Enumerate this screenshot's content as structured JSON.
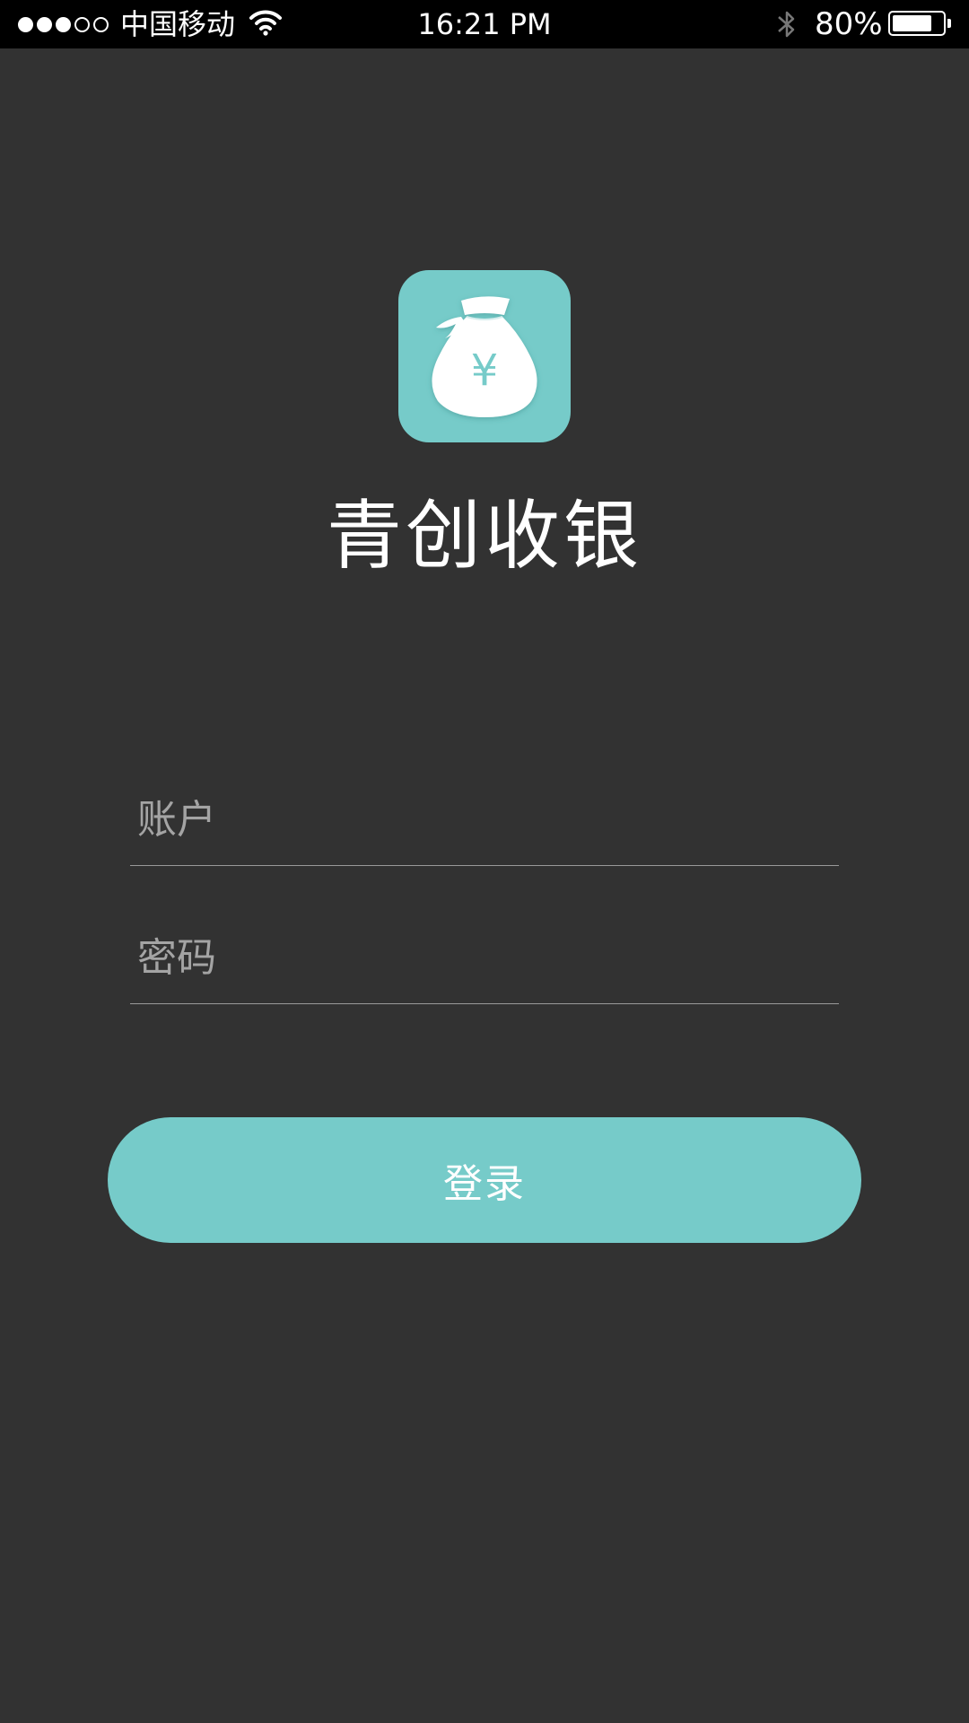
{
  "status_bar": {
    "carrier": "中国移动",
    "time": "16:21 PM",
    "battery_text": "80%",
    "battery_level": 0.8,
    "signal_strength": 3,
    "signal_max": 5
  },
  "app": {
    "title": "青创收银",
    "icon_symbol": "¥",
    "icon": "money-bag-icon"
  },
  "form": {
    "account_placeholder": "账户",
    "account_value": "",
    "password_placeholder": "密码",
    "password_value": ""
  },
  "login_button": {
    "label": "登录"
  },
  "colors": {
    "background": "#323232",
    "accent": "#76cbc9",
    "status_bar": "#000000"
  }
}
